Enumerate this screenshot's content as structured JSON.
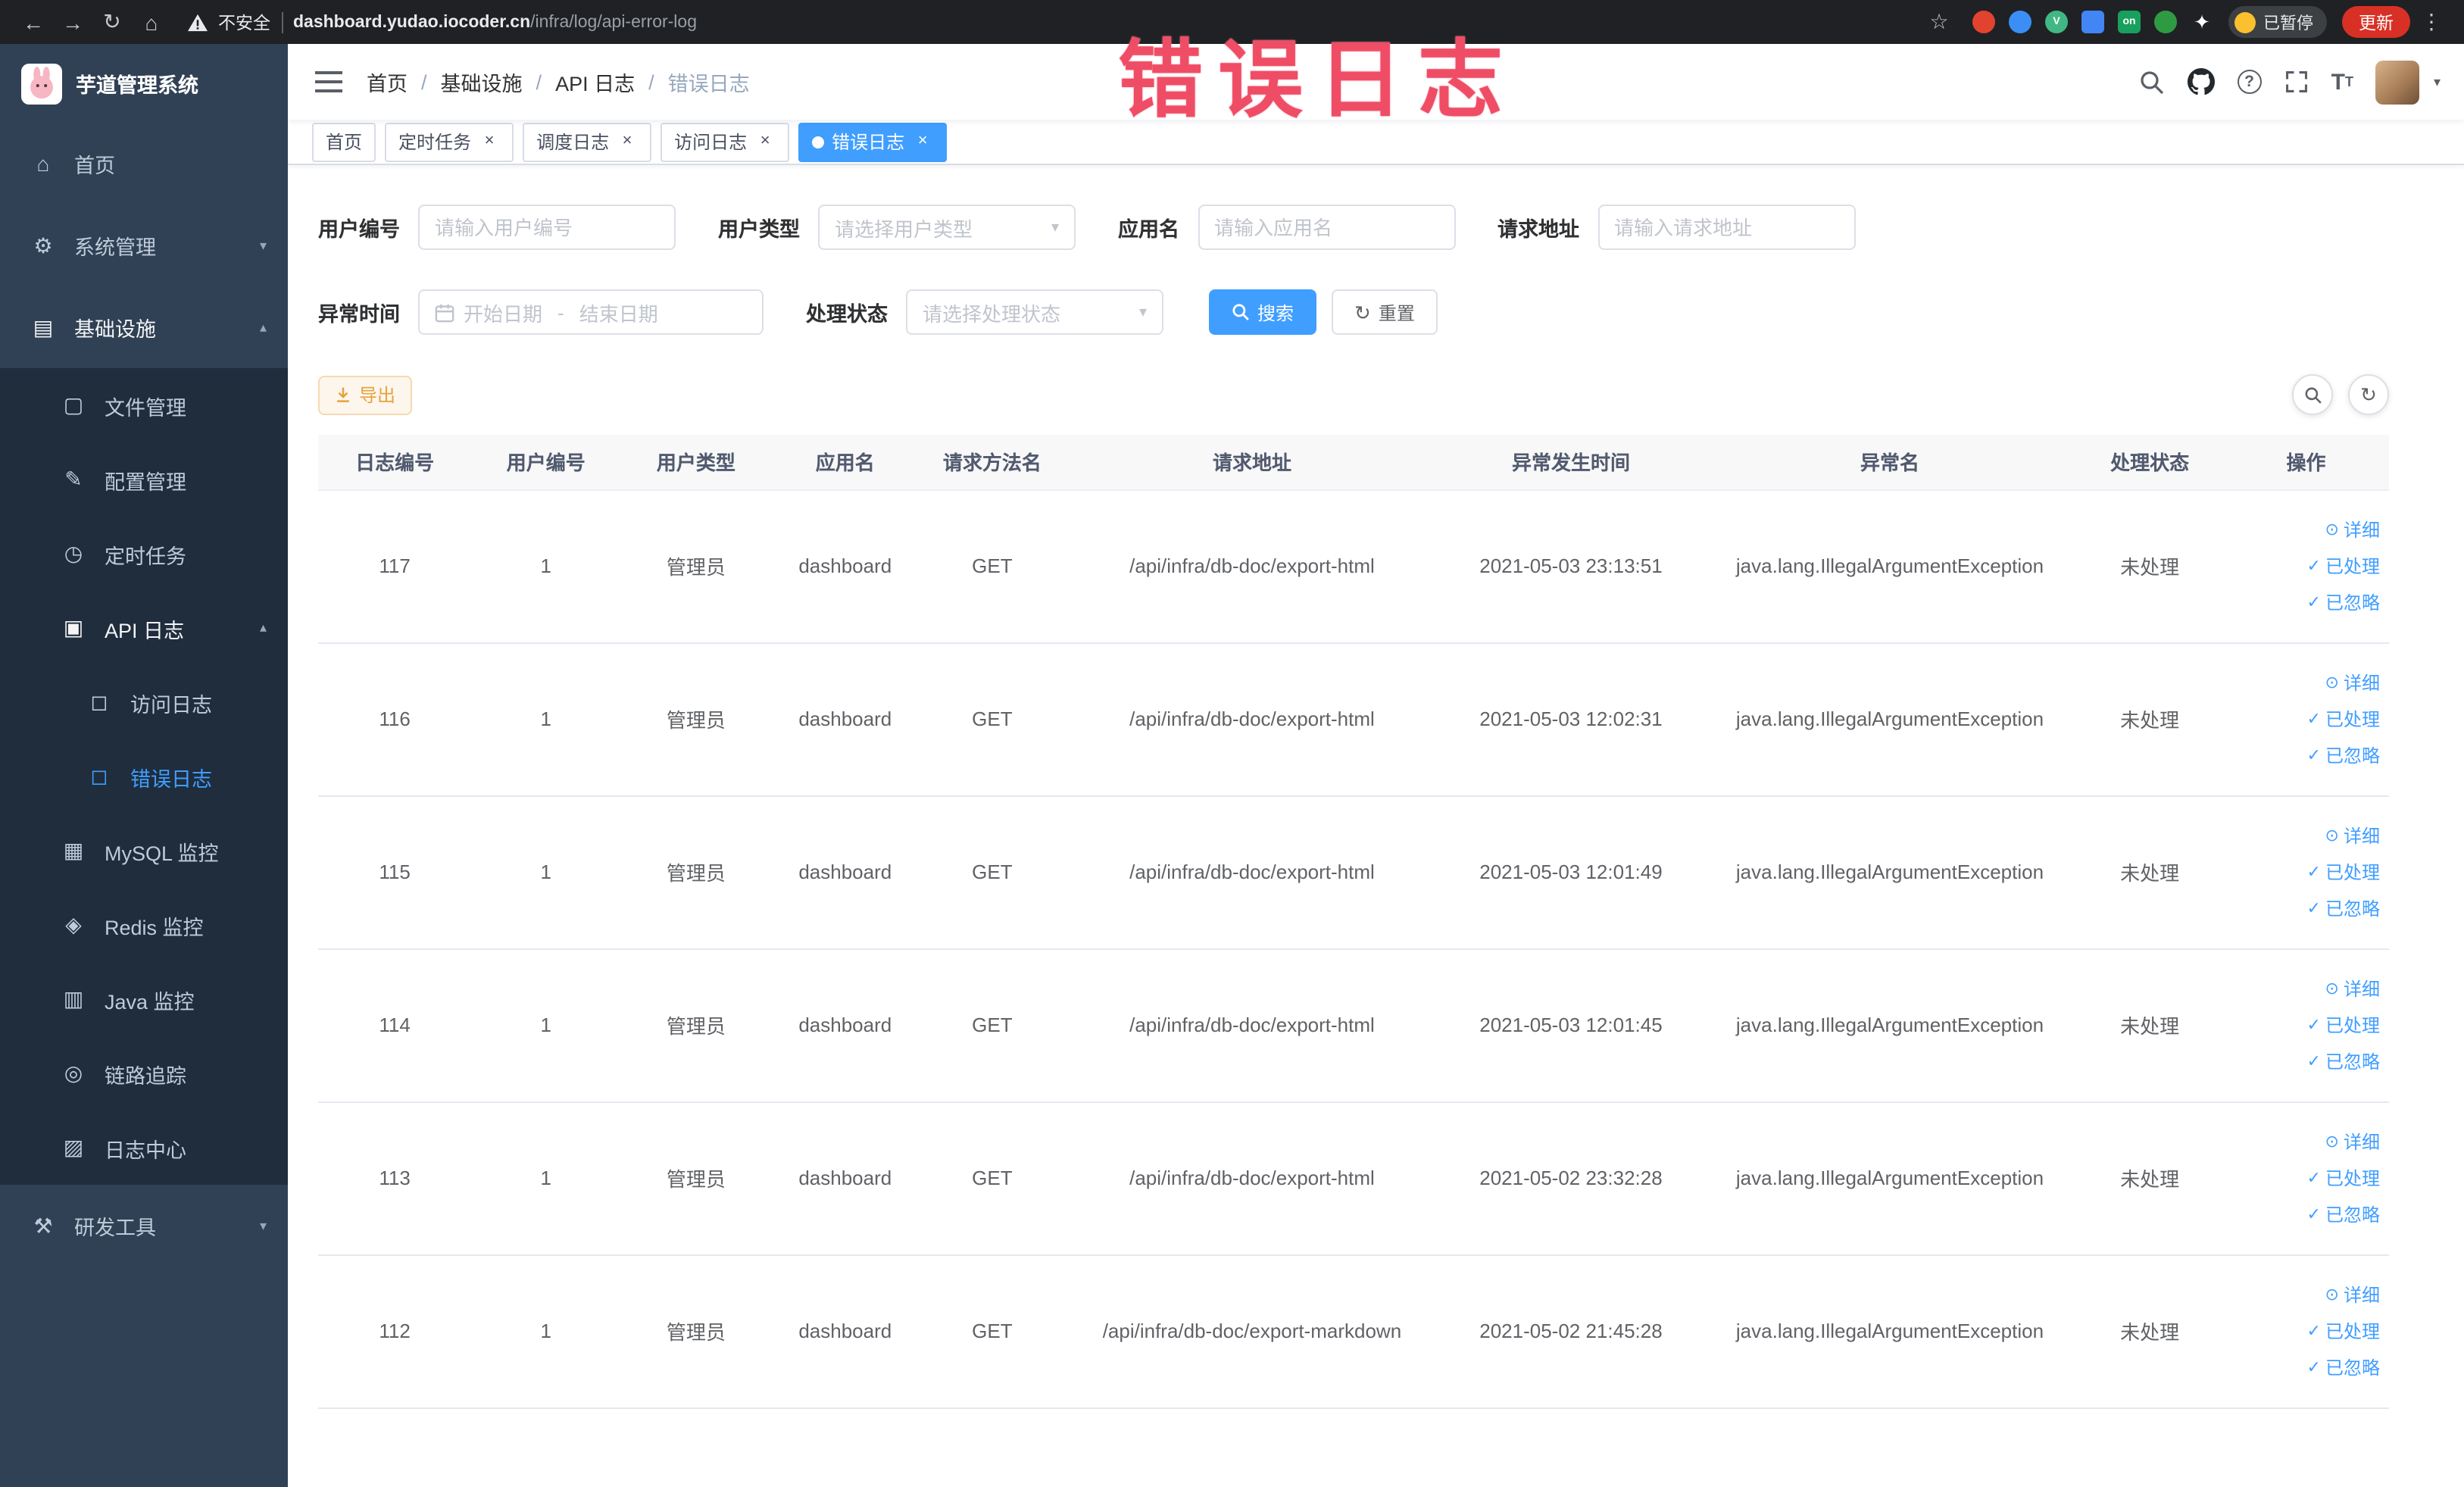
{
  "browser": {
    "security_label": "不安全",
    "url_host": "dashboard.yudao.iocoder.cn",
    "url_path": "/infra/log/api-error-log",
    "paused_button": "已暂停",
    "update_button": "更新",
    "extensions": [
      {
        "name": "red",
        "color": "#e2432f",
        "shape": "circle"
      },
      {
        "name": "blue-drop",
        "color": "#3a8ef6",
        "shape": "circle"
      },
      {
        "name": "vue-devtools",
        "color": "#41b883",
        "shape": "circle",
        "glyph": "V"
      },
      {
        "name": "grid",
        "color": "#4285f4",
        "shape": "square"
      },
      {
        "name": "on-badge",
        "color": "#17a05e",
        "shape": "square",
        "glyph": "on"
      },
      {
        "name": "tree",
        "color": "#2e9b43",
        "shape": "circle"
      },
      {
        "name": "pinwheel",
        "color": "#e8eaed",
        "shape": "star",
        "glyph": "✦"
      }
    ]
  },
  "watermark": {
    "text": "错误日志"
  },
  "sidebar": {
    "logo_title": "芋道管理系统",
    "items": [
      {
        "name": "home",
        "label": "首页",
        "icon": "home",
        "level": 1
      },
      {
        "name": "system-management",
        "label": "系统管理",
        "icon": "gear",
        "level": 1,
        "expandable": true,
        "expanded": false
      },
      {
        "name": "infrastructure",
        "label": "基础设施",
        "icon": "infra",
        "level": 1,
        "expandable": true,
        "expanded": true,
        "highlighted": true
      },
      {
        "name": "file-management",
        "label": "文件管理",
        "icon": "file",
        "level": 2
      },
      {
        "name": "config-management",
        "label": "配置管理",
        "icon": "config",
        "level": 2
      },
      {
        "name": "scheduled-tasks",
        "label": "定时任务",
        "icon": "timer",
        "level": 2
      },
      {
        "name": "api-log",
        "label": "API 日志",
        "icon": "api-log",
        "level": 2,
        "expandable": true,
        "expanded": true,
        "highlighted": true
      },
      {
        "name": "access-log",
        "label": "访问日志",
        "icon": "doc",
        "level": 3
      },
      {
        "name": "error-log",
        "label": "错误日志",
        "icon": "doc",
        "level": 3,
        "active": true
      },
      {
        "name": "mysql-monitor",
        "label": "MySQL 监控",
        "icon": "mysql",
        "level": 2
      },
      {
        "name": "redis-monitor",
        "label": "Redis 监控",
        "icon": "redis",
        "level": 2
      },
      {
        "name": "java-monitor",
        "label": "Java 监控",
        "icon": "java",
        "level": 2
      },
      {
        "name": "trace",
        "label": "链路追踪",
        "icon": "trace",
        "level": 2
      },
      {
        "name": "log-center",
        "label": "日志中心",
        "icon": "log-center",
        "level": 2
      },
      {
        "name": "dev-tools",
        "label": "研发工具",
        "icon": "tools",
        "level": 1,
        "expandable": true,
        "expanded": false
      }
    ]
  },
  "header": {
    "breadcrumbs": [
      {
        "name": "home",
        "label": "首页"
      },
      {
        "name": "infrastructure",
        "label": "基础设施"
      },
      {
        "name": "api-log",
        "label": "API 日志"
      },
      {
        "name": "error-log",
        "label": "错误日志",
        "current": true
      }
    ]
  },
  "tabs": [
    {
      "name": "home",
      "label": "首页"
    },
    {
      "name": "scheduled-tasks",
      "label": "定时任务",
      "closable": true
    },
    {
      "name": "job-log",
      "label": "调度日志",
      "closable": true
    },
    {
      "name": "access-log",
      "label": "访问日志",
      "closable": true
    },
    {
      "name": "error-log",
      "label": "错误日志",
      "closable": true,
      "active": true
    }
  ],
  "filters": {
    "user_id_label": "用户编号",
    "user_id_placeholder": "请输入用户编号",
    "user_type_label": "用户类型",
    "user_type_placeholder": "请选择用户类型",
    "app_name_label": "应用名",
    "app_name_placeholder": "请输入应用名",
    "request_url_label": "请求地址",
    "request_url_placeholder": "请输入请求地址",
    "exception_time_label": "异常时间",
    "date_start_placeholder": "开始日期",
    "date_separator": "-",
    "date_end_placeholder": "结束日期",
    "process_status_label": "处理状态",
    "process_status_placeholder": "请选择处理状态",
    "search_button": "搜索",
    "reset_button": "重置"
  },
  "toolbar": {
    "export_button": "导出"
  },
  "table": {
    "columns": [
      "日志编号",
      "用户编号",
      "用户类型",
      "应用名",
      "请求方法名",
      "请求地址",
      "异常发生时间",
      "异常名",
      "处理状态",
      "操作"
    ],
    "row_actions": [
      "详细",
      "已处理",
      "已忽略"
    ],
    "rows": [
      {
        "log_id": "117",
        "user_id": "1",
        "user_type": "管理员",
        "app_name": "dashboard",
        "method": "GET",
        "url": "/api/infra/db-doc/export-html",
        "time": "2021-05-03 23:13:51",
        "exception": "java.lang.IllegalArgumentException",
        "status": "未处理"
      },
      {
        "log_id": "116",
        "user_id": "1",
        "user_type": "管理员",
        "app_name": "dashboard",
        "method": "GET",
        "url": "/api/infra/db-doc/export-html",
        "time": "2021-05-03 12:02:31",
        "exception": "java.lang.IllegalArgumentException",
        "status": "未处理"
      },
      {
        "log_id": "115",
        "user_id": "1",
        "user_type": "管理员",
        "app_name": "dashboard",
        "method": "GET",
        "url": "/api/infra/db-doc/export-html",
        "time": "2021-05-03 12:01:49",
        "exception": "java.lang.IllegalArgumentException",
        "status": "未处理"
      },
      {
        "log_id": "114",
        "user_id": "1",
        "user_type": "管理员",
        "app_name": "dashboard",
        "method": "GET",
        "url": "/api/infra/db-doc/export-html",
        "time": "2021-05-03 12:01:45",
        "exception": "java.lang.IllegalArgumentException",
        "status": "未处理"
      },
      {
        "log_id": "113",
        "user_id": "1",
        "user_type": "管理员",
        "app_name": "dashboard",
        "method": "GET",
        "url": "/api/infra/db-doc/export-html",
        "time": "2021-05-02 23:32:28",
        "exception": "java.lang.IllegalArgumentException",
        "status": "未处理"
      },
      {
        "log_id": "112",
        "user_id": "1",
        "user_type": "管理员",
        "app_name": "dashboard",
        "method": "GET",
        "url": "/api/infra/db-doc/export-markdown",
        "time": "2021-05-02 21:45:28",
        "exception": "java.lang.IllegalArgumentException",
        "status": "未处理"
      }
    ]
  },
  "colors": {
    "accent": "#409EFF",
    "sidebar_bg": "#304156",
    "submenu_bg": "#1f2d3d",
    "watermark": "#ef4d66",
    "warning": "#e6a23c"
  }
}
